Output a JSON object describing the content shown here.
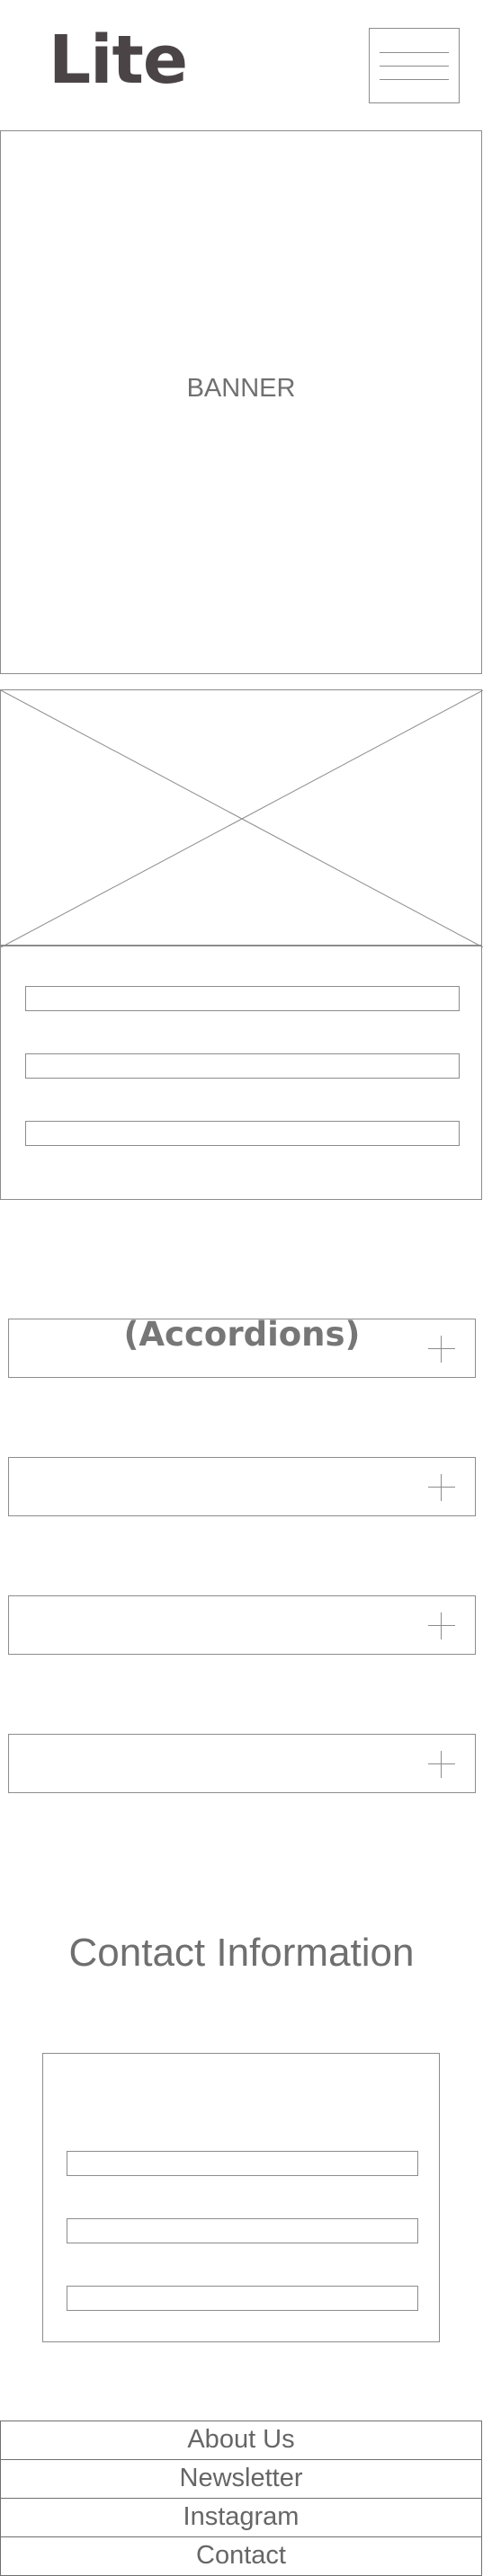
{
  "header": {
    "logo": "Lite"
  },
  "banner": {
    "label": "BANNER"
  },
  "accordions": {
    "items": [
      {
        "title": "(Accordions)"
      },
      {
        "title": ""
      },
      {
        "title": ""
      },
      {
        "title": ""
      }
    ]
  },
  "contact": {
    "heading": "Contact Information"
  },
  "footer": {
    "links": [
      {
        "label": "About Us"
      },
      {
        "label": "Newsletter"
      },
      {
        "label": "Instagram"
      },
      {
        "label": "Contact"
      }
    ]
  }
}
